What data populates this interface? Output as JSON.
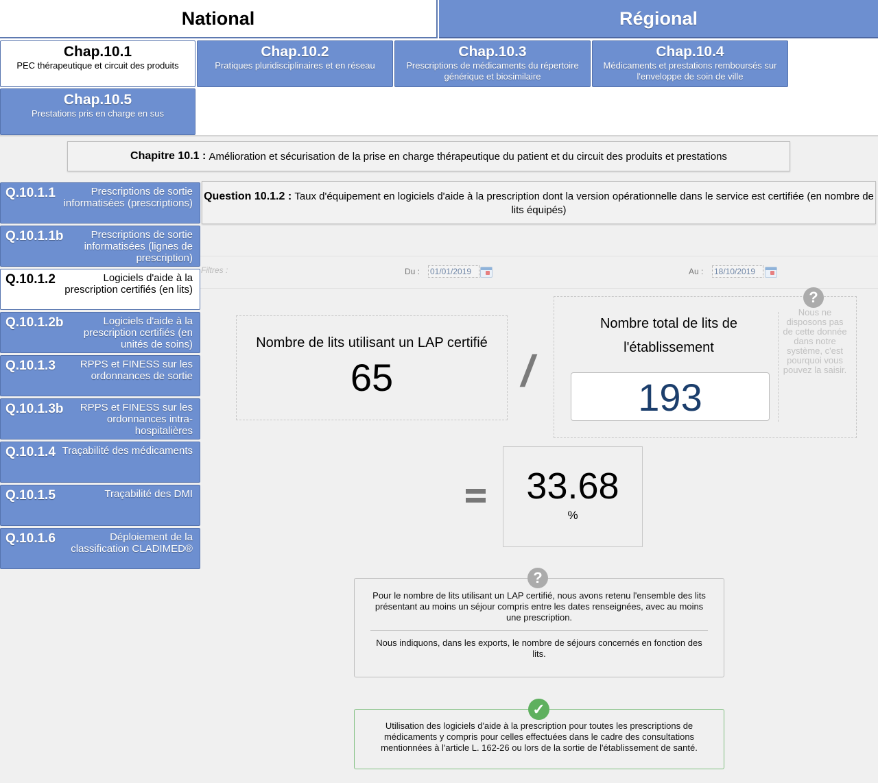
{
  "top_tabs": {
    "national": "National",
    "regional": "Régional"
  },
  "chapters": [
    {
      "code": "Chap.10.1",
      "label": "PEC thérapeutique et circuit des produits",
      "active": true
    },
    {
      "code": "Chap.10.2",
      "label": "Pratiques pluridisciplinaires et en réseau",
      "active": false
    },
    {
      "code": "Chap.10.3",
      "label": "Prescriptions de médicaments du répertoire générique et biosimilaire",
      "active": false
    },
    {
      "code": "Chap.10.4",
      "label": "Médicaments et prestations remboursés sur l'enveloppe de soin de ville",
      "active": false
    },
    {
      "code": "Chap.10.5",
      "label": "Prestations pris en charge en sus",
      "active": false
    }
  ],
  "chapter_header": {
    "prefix": "Chapitre 10.1 :",
    "title": "Amélioration et sécurisation de la prise en charge thérapeutique du patient et du circuit des produits et prestations"
  },
  "questions": [
    {
      "code": "Q.10.1.1",
      "label": "Prescriptions de sortie informatisées (prescriptions)",
      "active": false
    },
    {
      "code": "Q.10.1.1b",
      "label": "Prescriptions de sortie informatisées (lignes de prescription)",
      "active": false
    },
    {
      "code": "Q.10.1.2",
      "label": "Logiciels d'aide à la prescription certifiés (en lits)",
      "active": true
    },
    {
      "code": "Q.10.1.2b",
      "label": "Logiciels d'aide à la prescription certifiés (en unités de soins)",
      "active": false
    },
    {
      "code": "Q.10.1.3",
      "label": "RPPS et FINESS sur les ordonnances de sortie",
      "active": false
    },
    {
      "code": "Q.10.1.3b",
      "label": "RPPS et FINESS sur les ordonnances intra-hospitalières",
      "active": false
    },
    {
      "code": "Q.10.1.4",
      "label": "Traçabilité des médicaments",
      "active": false
    },
    {
      "code": "Q.10.1.5",
      "label": "Traçabilité des DMI",
      "active": false
    },
    {
      "code": "Q.10.1.6",
      "label": "Déploiement de la classification CLADIMED®",
      "active": false
    }
  ],
  "question_header": {
    "prefix": "Question 10.1.2 :",
    "title": "Taux d'équipement en logiciels d'aide à la prescription dont la version opérationnelle dans le service est certifiée (en nombre de lits équipés)"
  },
  "filters": {
    "label": "Filtres :",
    "from_label": "Du :",
    "from_value": "01/01/2019",
    "to_label": "Au :",
    "to_value": "18/10/2019"
  },
  "numerator": {
    "label": "Nombre de lits utilisant un LAP certifié",
    "value": "65"
  },
  "divide_symbol": "/",
  "denominator": {
    "label": "Nombre total de lits de l'établissement",
    "value": "193",
    "note": "Nous ne disposons pas de cette donnée dans notre système, c'est pourquoi vous pouvez la saisir."
  },
  "result": {
    "value": "33.68",
    "unit": "%"
  },
  "info_box": {
    "paragraph1": "Pour le nombre de lits utilisant un LAP certifié, nous avons retenu l'ensemble des lits présentant au moins un séjour compris entre les dates renseignées, avec au moins une prescription.",
    "paragraph2": "Nous indiquons, dans les exports, le nombre de séjours concernés en fonction des lits."
  },
  "success_box": {
    "text": "Utilisation des logiciels d'aide à la prescription pour toutes les prescriptions de médicaments y compris pour celles effectuées dans le cadre des consultations mentionnées à l'article L. 162-26 ou lors de la sortie de l'établissement de santé."
  },
  "icons": {
    "help": "?",
    "check": "✓"
  },
  "colors": {
    "accent_blue": "#6d8fd0",
    "value_blue": "#1b3e6c",
    "success_green": "#5fb05f",
    "help_gray": "#ababab"
  }
}
